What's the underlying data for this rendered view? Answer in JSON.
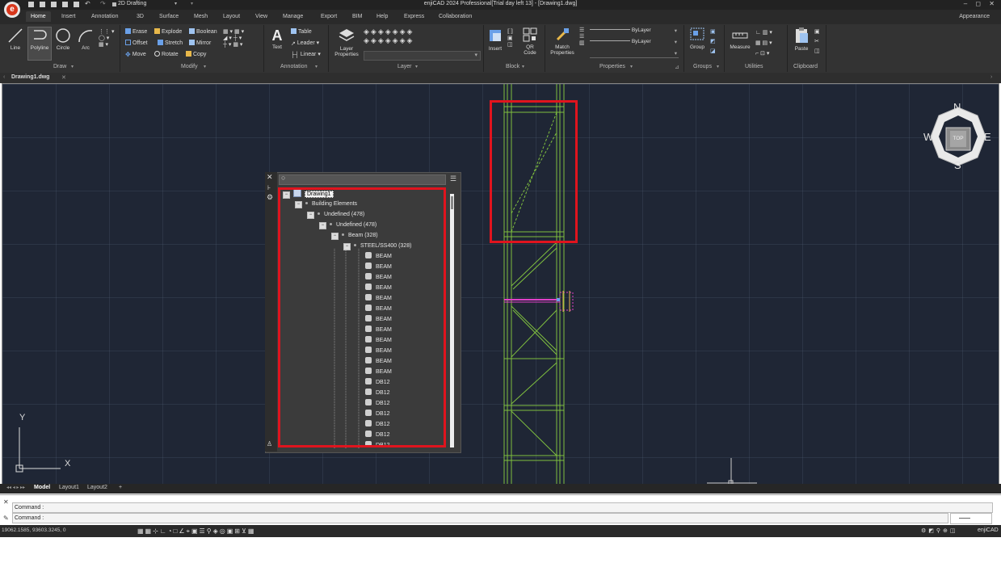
{
  "app": {
    "title": "enjiCAD 2024 Professional[Trial day left 13] - [Drawing1.dwg]",
    "workspace": "2D Drafting",
    "appearance_label": "Appearance",
    "window_controls": "– ◻ ✕",
    "brand": "enjiCAD"
  },
  "menu": {
    "tabs": [
      "Home",
      "Insert",
      "Annotation",
      "3D",
      "Surface",
      "Mesh",
      "Layout",
      "View",
      "Manage",
      "Export",
      "BIM",
      "Help",
      "Express",
      "Collaboration"
    ]
  },
  "ribbon": {
    "draw": {
      "label": "Draw",
      "tools": [
        "Line",
        "Polyline",
        "Circle",
        "Arc"
      ]
    },
    "modify": {
      "label": "Modify",
      "tools": [
        "Erase",
        "Explode",
        "Boolean",
        "Offset",
        "Stretch",
        "Mirror",
        "Move",
        "Rotate",
        "Copy"
      ]
    },
    "annotation": {
      "label": "Annotation",
      "text": "Text",
      "table": "Table",
      "leader": "Leader",
      "linear": "Linear"
    },
    "layer": {
      "label": "Layer",
      "layer_properties": "Layer Properties"
    },
    "block": {
      "label": "Block",
      "insert": "Insert",
      "qr": "QR Code"
    },
    "properties": {
      "label": "Properties",
      "match": "Match Properties",
      "bylayer1": "ByLayer",
      "bylayer2": "ByLayer"
    },
    "groups": {
      "label": "Groups",
      "group": "Group"
    },
    "utilities": {
      "label": "Utilities",
      "measure": "Measure"
    },
    "clipboard": {
      "label": "Clipboard",
      "paste": "Paste"
    }
  },
  "document": {
    "tab": "Drawing1.dwg"
  },
  "viewcube": {
    "n": "N",
    "s": "S",
    "e": "E",
    "w": "W",
    "top": "TOP"
  },
  "tree": {
    "root": "Drawing1",
    "nodes": [
      {
        "label": "Building Elements",
        "level": 1
      },
      {
        "label": "Undefined (478)",
        "level": 2
      },
      {
        "label": "Undefined (478)",
        "level": 3
      },
      {
        "label": "Beam (328)",
        "level": 4
      },
      {
        "label": "STEEL/SS400 (328)",
        "level": 5
      }
    ],
    "items": [
      "BEAM",
      "BEAM",
      "BEAM",
      "BEAM",
      "BEAM",
      "BEAM",
      "BEAM",
      "BEAM",
      "BEAM",
      "BEAM",
      "BEAM",
      "BEAM",
      "DB12",
      "DB12",
      "DB12",
      "DB12",
      "DB12",
      "DB12",
      "DB12"
    ]
  },
  "ucs": {
    "x": "X",
    "y": "Y"
  },
  "layout_tabs": [
    "Model",
    "Layout1",
    "Layout2",
    "+"
  ],
  "command": {
    "line1": "Command :",
    "line2": "Command :"
  },
  "status": {
    "coords": "19062.1585, 93603.3245, 0"
  },
  "colors": {
    "highlight": "#e0141e",
    "structure": "#7fbf3f",
    "canvas": "#1f2635",
    "beam_selected": "#e040c8"
  }
}
